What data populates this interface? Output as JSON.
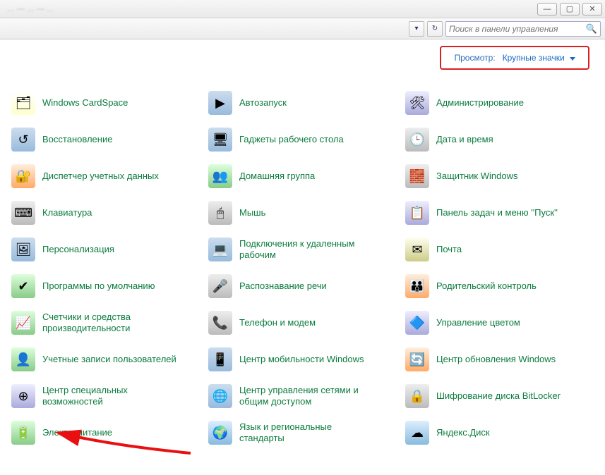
{
  "titlebar": {
    "blurred_title": "… — …  — …"
  },
  "toolbar": {
    "search_placeholder": "Поиск в панели управления"
  },
  "viewbar": {
    "label": "Просмотр:",
    "value": "Крупные значки"
  },
  "items": [
    {
      "name": "cardspace",
      "label": "Windows CardSpace",
      "icon_class": "c1",
      "glyph": "🗂"
    },
    {
      "name": "autorun",
      "label": "Автозапуск",
      "icon_class": "c2",
      "glyph": "▶"
    },
    {
      "name": "admin",
      "label": "Администрирование",
      "icon_class": "c6",
      "glyph": "🛠"
    },
    {
      "name": "recovery",
      "label": "Восстановление",
      "icon_class": "c2",
      "glyph": "↺"
    },
    {
      "name": "gadgets",
      "label": "Гаджеты рабочего стола",
      "icon_class": "c2",
      "glyph": "🖥"
    },
    {
      "name": "datetime",
      "label": "Дата и время",
      "icon_class": "c3",
      "glyph": "🕒"
    },
    {
      "name": "credential",
      "label": "Диспетчер учетных данных",
      "icon_class": "c5",
      "glyph": "🔐"
    },
    {
      "name": "homegroup",
      "label": "Домашняя группа",
      "icon_class": "c4",
      "glyph": "👥"
    },
    {
      "name": "defender",
      "label": "Защитник Windows",
      "icon_class": "c3",
      "glyph": "🧱"
    },
    {
      "name": "keyboard",
      "label": "Клавиатура",
      "icon_class": "c3",
      "glyph": "⌨"
    },
    {
      "name": "mouse",
      "label": "Мышь",
      "icon_class": "c3",
      "glyph": "🖱"
    },
    {
      "name": "taskbar",
      "label": "Панель задач и меню ''Пуск''",
      "icon_class": "c6",
      "glyph": "📋"
    },
    {
      "name": "personalize",
      "label": "Персонализация",
      "icon_class": "c2",
      "glyph": "🖼"
    },
    {
      "name": "remote",
      "label": "Подключения к удаленным рабочим",
      "icon_class": "c2",
      "glyph": "💻"
    },
    {
      "name": "mail",
      "label": "Почта",
      "icon_class": "c7",
      "glyph": "✉"
    },
    {
      "name": "defaults",
      "label": "Программы по умолчанию",
      "icon_class": "c4",
      "glyph": "✔"
    },
    {
      "name": "speech",
      "label": "Распознавание речи",
      "icon_class": "c3",
      "glyph": "🎤"
    },
    {
      "name": "parental",
      "label": "Родительский контроль",
      "icon_class": "c5",
      "glyph": "👪"
    },
    {
      "name": "perfmon",
      "label": "Счетчики и средства производительности",
      "icon_class": "c4",
      "glyph": "📈"
    },
    {
      "name": "phone",
      "label": "Телефон и модем",
      "icon_class": "c3",
      "glyph": "📞"
    },
    {
      "name": "color",
      "label": "Управление цветом",
      "icon_class": "c6",
      "glyph": "🔷"
    },
    {
      "name": "users",
      "label": "Учетные записи пользователей",
      "icon_class": "c4",
      "glyph": "👤"
    },
    {
      "name": "mobility",
      "label": "Центр мобильности Windows",
      "icon_class": "c2",
      "glyph": "📱"
    },
    {
      "name": "update",
      "label": "Центр обновления Windows",
      "icon_class": "c5",
      "glyph": "🔄"
    },
    {
      "name": "ease",
      "label": "Центр специальных возможностей",
      "icon_class": "c6",
      "glyph": "⊕"
    },
    {
      "name": "network",
      "label": "Центр управления сетями и общим доступом",
      "icon_class": "c2",
      "glyph": "🌐"
    },
    {
      "name": "bitlocker",
      "label": "Шифрование диска BitLocker",
      "icon_class": "c3",
      "glyph": "🔒"
    },
    {
      "name": "power",
      "label": "Электропитание",
      "icon_class": "c4",
      "glyph": "🔋"
    },
    {
      "name": "region",
      "label": "Язык и региональные стандарты",
      "icon_class": "c9",
      "glyph": "🌍"
    },
    {
      "name": "yadisk",
      "label": "Яндекс.Диск",
      "icon_class": "c9",
      "glyph": "☁"
    }
  ]
}
